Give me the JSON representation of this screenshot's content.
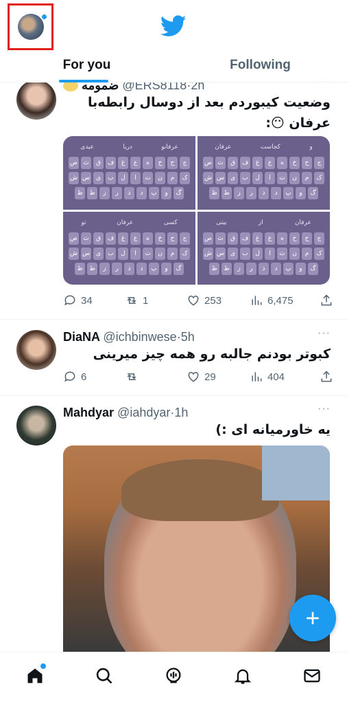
{
  "header": {
    "tabs": [
      {
        "label": "For you",
        "active": true
      },
      {
        "label": "Following",
        "active": false
      }
    ],
    "brand_color": "#1d9bf0"
  },
  "posts": [
    {
      "name": "ضمومه",
      "handle": "@ERS8118",
      "time": "2h",
      "text": "وضعیت کیبوردم بعد از دوسال رابطه‌با عرفان 😶:",
      "keyboard_suggestions": [
        [
          "عیدی",
          "دریا",
          "عرفانو"
        ],
        [
          "عرفان",
          "کجاست",
          "و"
        ],
        [
          "تو",
          "عرفان",
          "کسی"
        ],
        [
          "بیتی",
          "از",
          "عرفان"
        ]
      ],
      "keyboard_rows": [
        [
          "ص",
          "ث",
          "ق",
          "ف",
          "غ",
          "ع",
          "ه",
          "خ",
          "ح",
          "ج"
        ],
        [
          "ش",
          "س",
          "ی",
          "ب",
          "ل",
          "ا",
          "ت",
          "ن",
          "م",
          "ک"
        ],
        [
          "ظ",
          "ط",
          "ز",
          "ر",
          "ذ",
          "د",
          "پ",
          "و",
          "گ"
        ]
      ],
      "stats": {
        "replies": "34",
        "retweets": "1",
        "likes": "253",
        "views": "6,475"
      }
    },
    {
      "name": "DiaNA",
      "handle": "@ichbinwese",
      "time": "5h",
      "text": "کبوتر بودنم جالبه رو همه چیز میرینی",
      "stats": {
        "replies": "6",
        "retweets": "",
        "likes": "29",
        "views": "404"
      }
    },
    {
      "name": "Mahdyar",
      "handle": "@iahdyar",
      "time": "1h",
      "text": "یه خاورمیانه ای :)",
      "stats": {}
    }
  ],
  "icons": {
    "fab": "plus-icon",
    "nav": [
      "home-icon",
      "search-icon",
      "spaces-icon",
      "bell-icon",
      "mail-icon"
    ]
  },
  "fab_label": "+"
}
